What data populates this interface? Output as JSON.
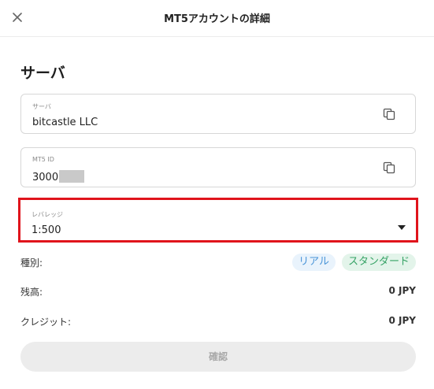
{
  "header": {
    "title": "MT5アカウントの詳細",
    "close_icon": "close-icon"
  },
  "section": {
    "title": "サーバ"
  },
  "fields": {
    "server": {
      "label": "サーバ",
      "value": "bitcastle LLC",
      "icon": "copy-icon"
    },
    "mt5_id": {
      "label": "MT5 ID",
      "value": "3000",
      "icon": "copy-icon"
    },
    "leverage": {
      "label": "レバレッジ",
      "value": "1:500",
      "icon": "caret-down-icon"
    }
  },
  "info": {
    "type": {
      "label": "種別:",
      "badges": [
        "リアル",
        "スタンダード"
      ]
    },
    "balance": {
      "label": "残高:",
      "value": "0 JPY"
    },
    "credit": {
      "label": "クレジット:",
      "value": "0 JPY"
    }
  },
  "confirm": {
    "label": "確認"
  },
  "colors": {
    "highlight_border": "#e0141c",
    "badge_real_bg": "#e9f3fc",
    "badge_real_text": "#4a95d8",
    "badge_standard_bg": "#e3f4ea",
    "badge_standard_text": "#37a366",
    "button_disabled_bg": "#ececec"
  }
}
